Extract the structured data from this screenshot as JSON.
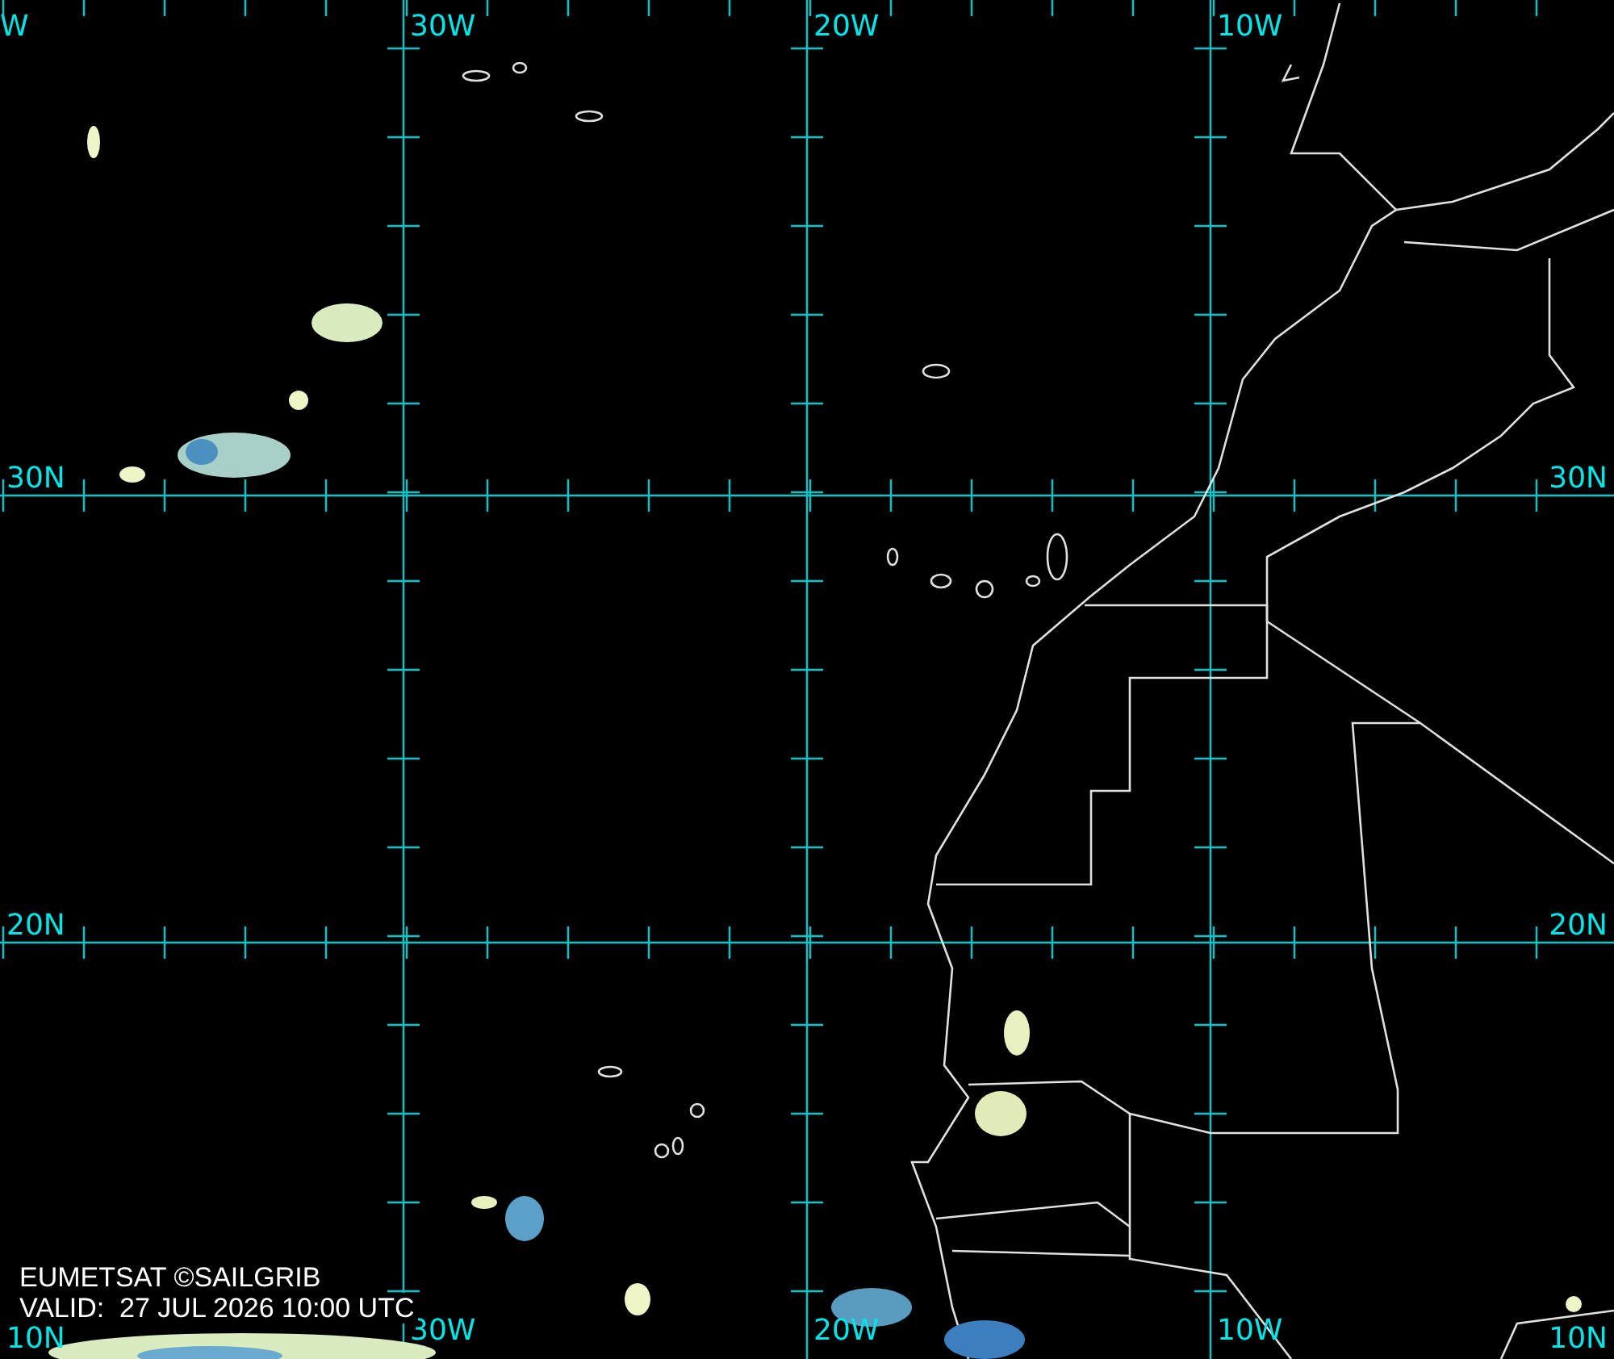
{
  "map": {
    "top_labels": [
      "W",
      "30W",
      "20W",
      "10W"
    ],
    "left_labels": [
      "30N",
      "20N",
      "10N"
    ],
    "right_labels": [
      "30N",
      "20N",
      "10N"
    ],
    "bottom_labels": [
      "30W",
      "20W",
      "10W"
    ],
    "caption": {
      "source": "EUMETSAT ©SAILGRIB",
      "valid": "VALID:  27 JUL 2026 10:00 UTC"
    }
  }
}
